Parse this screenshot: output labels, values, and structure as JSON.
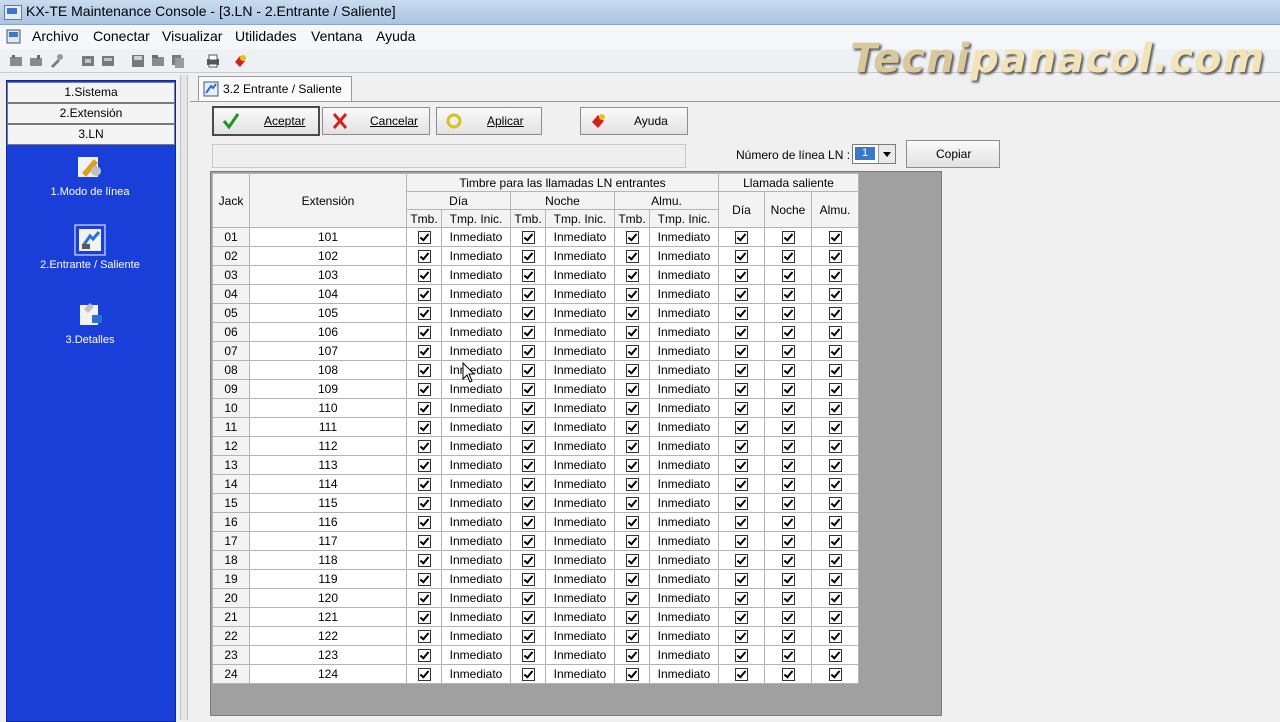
{
  "window": {
    "title": "KX-TE Maintenance Console - [3.LN - 2.Entrante / Saliente]"
  },
  "menu": [
    "Archivo",
    "Conectar",
    "Visualizar",
    "Utilidades",
    "Ventana",
    "Ayuda"
  ],
  "watermark": {
    "part1": "Tecni",
    "part2": "panacol.com"
  },
  "sidebar": {
    "tabs": [
      "1.Sistema",
      "2.Extensión",
      "3.LN"
    ],
    "items": [
      "1.Modo de línea",
      "2.Entrante / Saliente",
      "3.Detalles"
    ]
  },
  "tab": {
    "label": "3.2 Entrante / Saliente"
  },
  "buttons": {
    "accept": "Aceptar",
    "cancel": "Cancelar",
    "apply": "Aplicar",
    "help": "Ayuda",
    "copy": "Copiar"
  },
  "line_selector": {
    "label": "Número de línea LN :",
    "value": "1"
  },
  "table": {
    "headers": {
      "jack": "Jack",
      "extension": "Extensión",
      "incoming_group": "Timbre para las llamadas LN entrantes",
      "outgoing_group": "Llamada saliente",
      "day": "Día",
      "night": "Noche",
      "lunch": "Almu.",
      "tmb": "Tmb.",
      "tmp_inic": "Tmp. Inic."
    },
    "rows": [
      {
        "jack": "01",
        "ext": "101"
      },
      {
        "jack": "02",
        "ext": "102"
      },
      {
        "jack": "03",
        "ext": "103"
      },
      {
        "jack": "04",
        "ext": "104"
      },
      {
        "jack": "05",
        "ext": "105"
      },
      {
        "jack": "06",
        "ext": "106"
      },
      {
        "jack": "07",
        "ext": "107"
      },
      {
        "jack": "08",
        "ext": "108"
      },
      {
        "jack": "09",
        "ext": "109"
      },
      {
        "jack": "10",
        "ext": "110"
      },
      {
        "jack": "11",
        "ext": "111"
      },
      {
        "jack": "12",
        "ext": "112"
      },
      {
        "jack": "13",
        "ext": "113"
      },
      {
        "jack": "14",
        "ext": "114"
      },
      {
        "jack": "15",
        "ext": "115"
      },
      {
        "jack": "16",
        "ext": "116"
      },
      {
        "jack": "17",
        "ext": "117"
      },
      {
        "jack": "18",
        "ext": "118"
      },
      {
        "jack": "19",
        "ext": "119"
      },
      {
        "jack": "20",
        "ext": "120"
      },
      {
        "jack": "21",
        "ext": "121"
      },
      {
        "jack": "22",
        "ext": "122"
      },
      {
        "jack": "23",
        "ext": "123"
      },
      {
        "jack": "24",
        "ext": "124"
      }
    ],
    "cell_value": "Inmediato"
  }
}
